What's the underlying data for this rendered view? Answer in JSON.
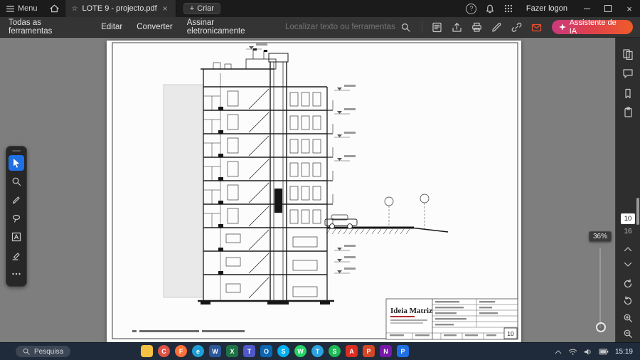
{
  "titlebar": {
    "menu_label": "Menu",
    "tab_title": "LOTE 9 - projecto.pdf",
    "create_label": "Criar",
    "signin_label": "Fazer logon",
    "right_icons": [
      "help-icon",
      "notifications-bell-icon",
      "apps-grid-icon"
    ]
  },
  "toolbar": {
    "items": [
      {
        "label": "Todas as ferramentas"
      },
      {
        "label": "Editar"
      },
      {
        "label": "Converter"
      },
      {
        "label": "Assinar eletronicamente"
      }
    ],
    "search_placeholder": "Localizar texto ou ferramentas",
    "right_icons": [
      "page-display-icon",
      "export-pdf-icon",
      "print-icon",
      "fill-sign-icon",
      "link-icon",
      "share-icon"
    ],
    "ai_label": "Assistente de IA",
    "ai_gradient": [
      "#c93a7c",
      "#ef5b2a"
    ]
  },
  "left_toolbar": {
    "tools": [
      "select",
      "zoom",
      "draw",
      "lasso",
      "add-text",
      "highlight",
      "more"
    ],
    "selected_tool": "select",
    "selected_color": "#1f6fe5"
  },
  "right_panel": {
    "icons": [
      "page-thumbnails",
      "comments",
      "bookmarks",
      "attachments"
    ],
    "current_page": "10",
    "total_pages": "16",
    "zoom_level": "36%",
    "nav_icons": [
      "previous-page",
      "next-page",
      "refresh",
      "rotate-view",
      "zoom-in",
      "zoom-out"
    ]
  },
  "document": {
    "type": "architectural-section-drawing",
    "titleblock": {
      "company": "Ideia Matriz",
      "sheet_number": "10"
    }
  },
  "taskbar": {
    "search_placeholder": "Pesquisa",
    "time": "15:19",
    "apps": [
      {
        "name": "file-explorer",
        "glyph": "",
        "color": "#f6c244",
        "round": false
      },
      {
        "name": "chrome",
        "glyph": "C",
        "color": "#de5246",
        "round": true
      },
      {
        "name": "firefox",
        "glyph": "F",
        "color": "#ff7139",
        "round": true
      },
      {
        "name": "edge",
        "glyph": "e",
        "color": "#1e9fd4",
        "round": true
      },
      {
        "name": "word",
        "glyph": "W",
        "color": "#2b579a",
        "round": false
      },
      {
        "name": "excel",
        "glyph": "X",
        "color": "#1e7145",
        "round": false
      },
      {
        "name": "teams",
        "glyph": "T",
        "color": "#5059c9",
        "round": false
      },
      {
        "name": "outlook",
        "glyph": "O",
        "color": "#0b67b2",
        "round": false
      },
      {
        "name": "skype",
        "glyph": "S",
        "color": "#00aff0",
        "round": true
      },
      {
        "name": "whatsapp",
        "glyph": "W",
        "color": "#25d366",
        "round": true
      },
      {
        "name": "telegram",
        "glyph": "T",
        "color": "#2aa3e0",
        "round": true
      },
      {
        "name": "spotify",
        "glyph": "S",
        "color": "#1db954",
        "round": true
      },
      {
        "name": "acrobat",
        "glyph": "A",
        "color": "#d92d20",
        "round": false
      },
      {
        "name": "powerpoint",
        "glyph": "P",
        "color": "#d24726",
        "round": false
      },
      {
        "name": "onenote",
        "glyph": "N",
        "color": "#7719aa",
        "round": false
      },
      {
        "name": "photos",
        "glyph": "P",
        "color": "#1f6fe5",
        "round": false
      }
    ]
  }
}
